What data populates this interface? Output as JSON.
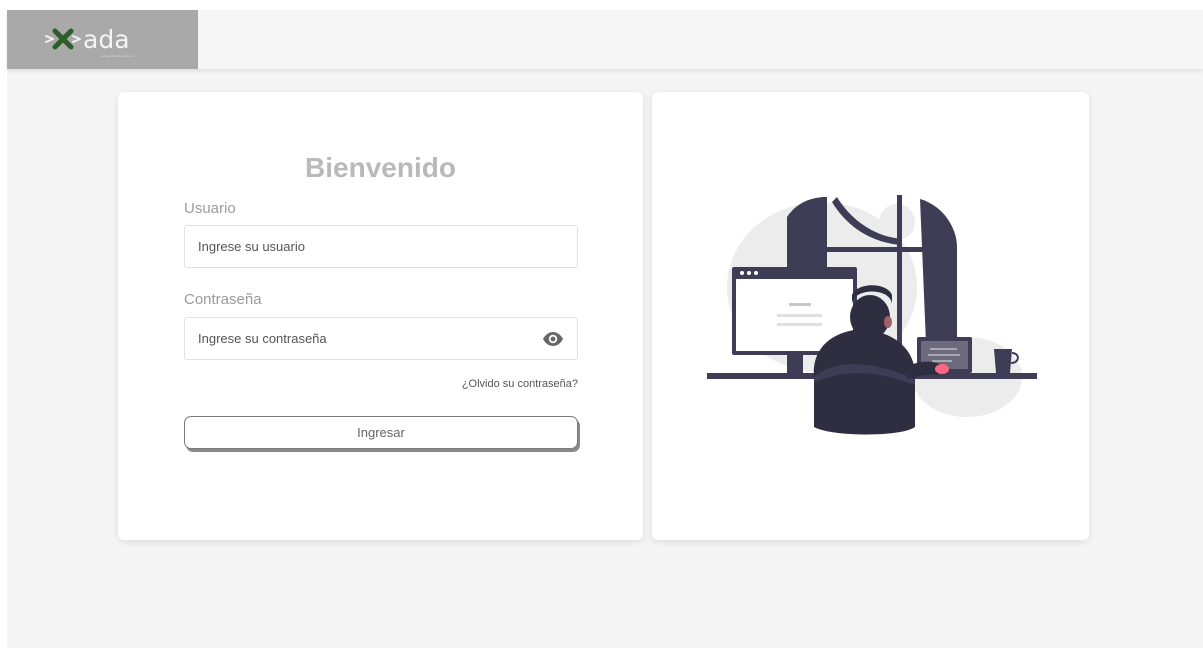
{
  "header": {
    "logo_text": "ada",
    "logo_tagline": "desarrollando valores"
  },
  "login": {
    "title": "Bienvenido",
    "username_label": "Usuario",
    "username_placeholder": "Ingrese su usuario",
    "password_label": "Contraseña",
    "password_placeholder": "Ingrese su contraseña",
    "forgot_link": "¿Olvido su contraseña?",
    "submit_label": "Ingresar"
  },
  "colors": {
    "logo_background": "#a9a9a9",
    "logo_accent": "#2e5e2a",
    "illustration_dark": "#3f3d56",
    "page_background": "#f5f5f5"
  },
  "icons": {
    "password_toggle": "eye-icon",
    "brand_mark": "arrow-x-icon"
  }
}
